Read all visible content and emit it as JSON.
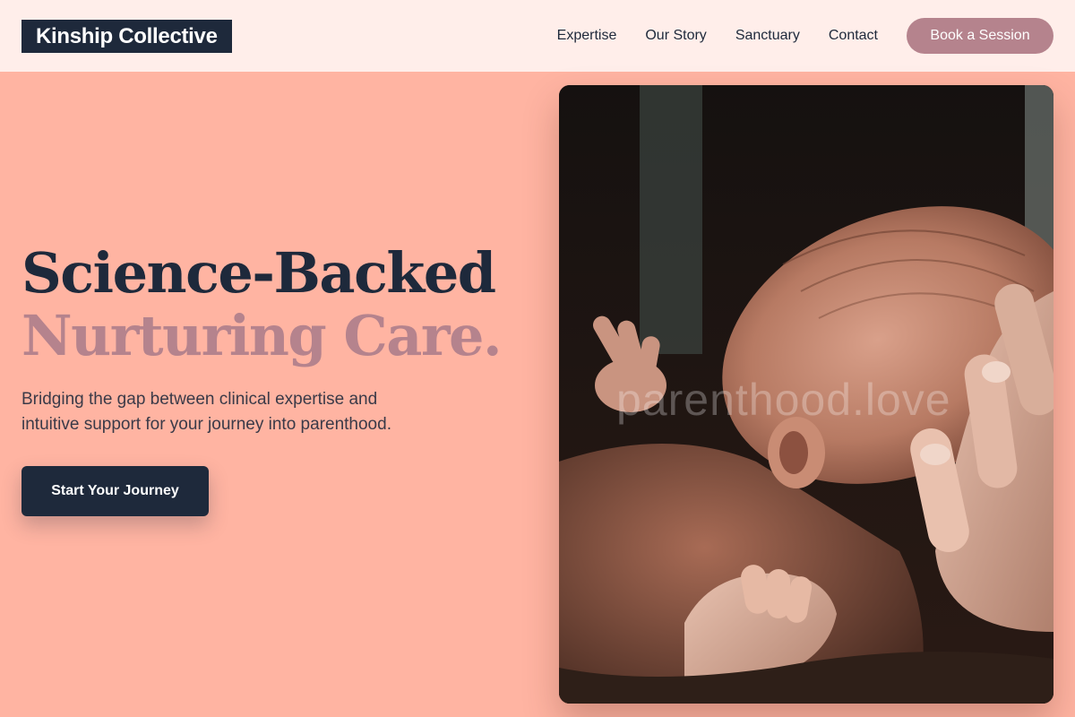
{
  "nav": {
    "logo": "Kinship Collective",
    "links": [
      {
        "label": "Expertise"
      },
      {
        "label": "Our Story"
      },
      {
        "label": "Sanctuary"
      },
      {
        "label": "Contact"
      }
    ],
    "cta": "Book a Session"
  },
  "hero": {
    "headline_line1": "Science-Backed",
    "headline_line2": "Nurturing Care.",
    "subtext": "Bridging the gap between clinical expertise and intuitive support for your journey into parenthood.",
    "cta": "Start Your Journey"
  },
  "photo": {
    "subject": "newborn-baby-held-in-hand-photo",
    "watermark": "parenthood.love"
  },
  "colors": {
    "page_background": "#FFB4A2",
    "nav_background": "#FFEEEA",
    "navy": "#1E293B",
    "mauve": "#B5838D"
  }
}
